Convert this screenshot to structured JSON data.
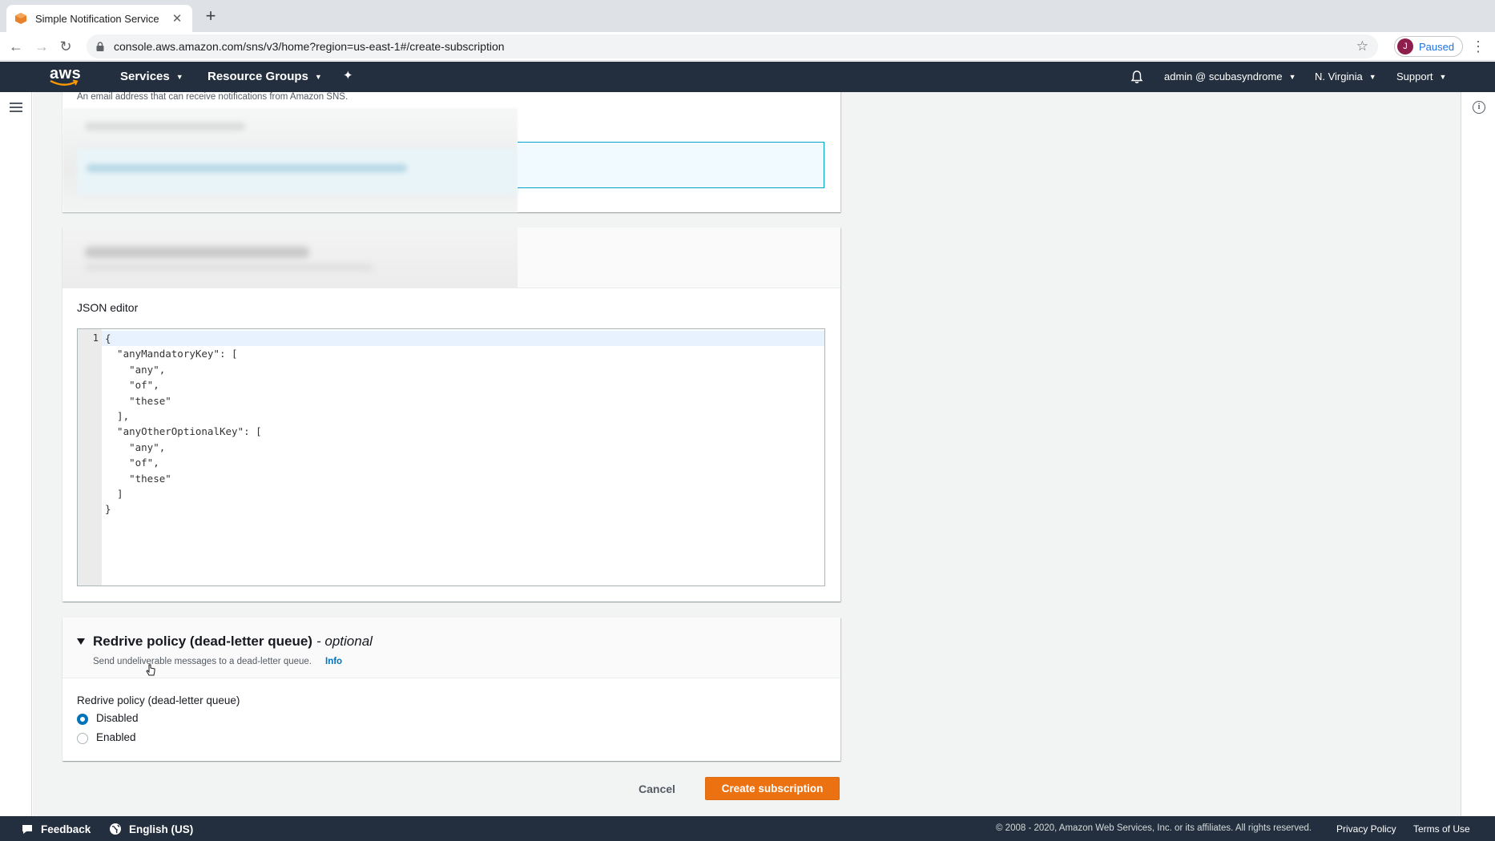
{
  "browser": {
    "tab_title": "Simple Notification Service",
    "url": "console.aws.amazon.com/sns/v3/home?region=us-east-1#/create-subscription",
    "profile_initial": "J",
    "profile_status": "Paused"
  },
  "header": {
    "logo_text": "aws",
    "services": "Services",
    "resource_groups": "Resource Groups",
    "account": "admin @ scubasyndrome",
    "region": "N. Virginia",
    "support": "Support"
  },
  "endpoint": {
    "hint": "An email address that can receive notifications from Amazon SNS."
  },
  "json_editor": {
    "label": "JSON editor",
    "line_number": "1",
    "lines": [
      "{",
      "  \"anyMandatoryKey\": [",
      "    \"any\",",
      "    \"of\",",
      "    \"these\"",
      "  ],",
      "  \"anyOtherOptionalKey\": [",
      "    \"any\",",
      "    \"of\",",
      "    \"these\"",
      "  ]",
      "}"
    ]
  },
  "redrive": {
    "title": "Redrive policy (dead-letter queue)",
    "optional": "- optional",
    "description": "Send undeliverable messages to a dead-letter queue.",
    "info": "Info",
    "group_label": "Redrive policy (dead-letter queue)",
    "options": [
      "Disabled",
      "Enabled"
    ],
    "selected": "Disabled"
  },
  "actions": {
    "cancel": "Cancel",
    "create": "Create subscription"
  },
  "footer": {
    "feedback": "Feedback",
    "language": "English (US)",
    "copyright": "© 2008 - 2020, Amazon Web Services, Inc. or its affiliates. All rights reserved.",
    "privacy": "Privacy Policy",
    "terms": "Terms of Use"
  },
  "colors": {
    "aws_nav": "#232f3e",
    "primary_button": "#ec7211",
    "link": "#0073bb"
  }
}
